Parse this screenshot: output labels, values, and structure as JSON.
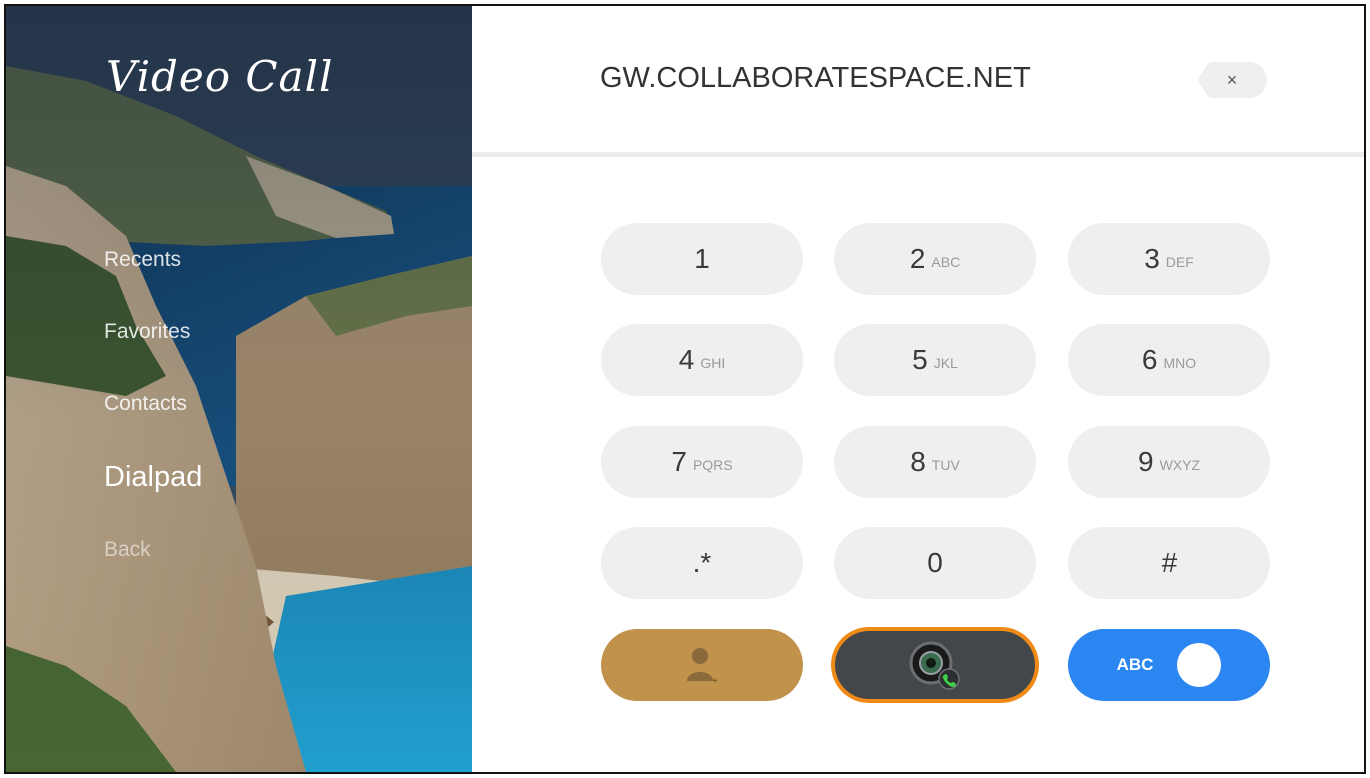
{
  "app": {
    "title": "Video Call"
  },
  "nav": {
    "items": [
      {
        "label": "Recents"
      },
      {
        "label": "Favorites"
      },
      {
        "label": "Contacts"
      },
      {
        "label": "Dialpad"
      },
      {
        "label": "Back"
      }
    ],
    "active": "Dialpad"
  },
  "header": {
    "address": "GW.COLLABORATESPACE.NET",
    "clear_icon": "×"
  },
  "dialpad": {
    "keys": [
      {
        "num": "1",
        "sub": ""
      },
      {
        "num": "2",
        "sub": "ABC"
      },
      {
        "num": "3",
        "sub": "DEF"
      },
      {
        "num": "4",
        "sub": "GHI"
      },
      {
        "num": "5",
        "sub": "JKL"
      },
      {
        "num": "6",
        "sub": "MNO"
      },
      {
        "num": "7",
        "sub": "PQRS"
      },
      {
        "num": "8",
        "sub": "TUV"
      },
      {
        "num": "9",
        "sub": "WXYZ"
      },
      {
        "num": ".*",
        "sub": ""
      },
      {
        "num": "0",
        "sub": ""
      },
      {
        "num": "#",
        "sub": ""
      }
    ]
  },
  "actions": {
    "contact_icon": "add-contact-icon",
    "call_icon": "video-call-icon",
    "toggle_label": "ABC"
  },
  "colors": {
    "contact_button": "#c0924b",
    "call_button": "#44474a",
    "call_highlight": "#ef8a16",
    "toggle_button": "#2b86f2"
  }
}
